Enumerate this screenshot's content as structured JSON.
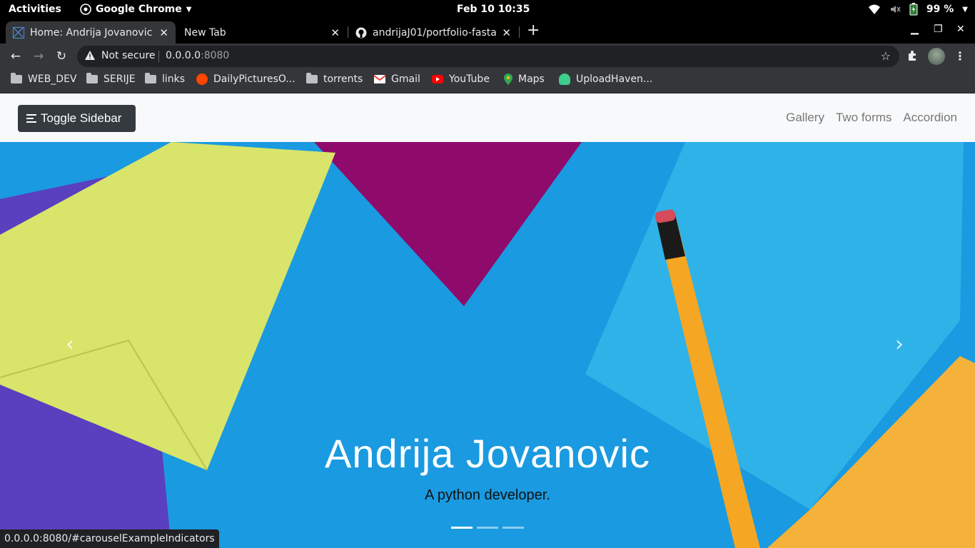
{
  "os": {
    "activities": "Activities",
    "app_name": "Google Chrome",
    "clock": "Feb 10  10:35",
    "battery": "99 %"
  },
  "tabs": [
    {
      "title": "Home: Andrija Jovanovic",
      "active": true
    },
    {
      "title": "New Tab",
      "active": false
    },
    {
      "title": "andrijaJ01/portfolio-fasta",
      "active": false
    }
  ],
  "address_bar": {
    "security": "Not secure",
    "host": "0.0.0.0",
    "port": ":8080"
  },
  "bookmarks": [
    {
      "label": "WEB_DEV",
      "icon": "folder-icon"
    },
    {
      "label": "SERIJE",
      "icon": "folder-icon"
    },
    {
      "label": "links",
      "icon": "folder-icon"
    },
    {
      "label": "DailyPicturesO...",
      "icon": "reddit-icon"
    },
    {
      "label": "torrents",
      "icon": "folder-icon"
    },
    {
      "label": "Gmail",
      "icon": "gmail-icon"
    },
    {
      "label": "YouTube",
      "icon": "youtube-icon"
    },
    {
      "label": "Maps",
      "icon": "maps-icon"
    },
    {
      "label": "UploadHaven...",
      "icon": "cloud-icon"
    }
  ],
  "site": {
    "toggle_label": "Toggle Sidebar",
    "nav": [
      "Gallery",
      "Two forms",
      "Accordion"
    ],
    "hero_title": "Andrija Jovanovic",
    "hero_subtitle": "A python developer.",
    "slides": 3,
    "active_slide": 1
  },
  "status_url": "0.0.0.0:8080/#carouselExampleIndicators",
  "colors": {
    "hero_bg": "#1ea0e6",
    "navbar_bg": "#f8f9fa",
    "button_bg": "#343a40",
    "chrome_dark": "#35363a"
  }
}
